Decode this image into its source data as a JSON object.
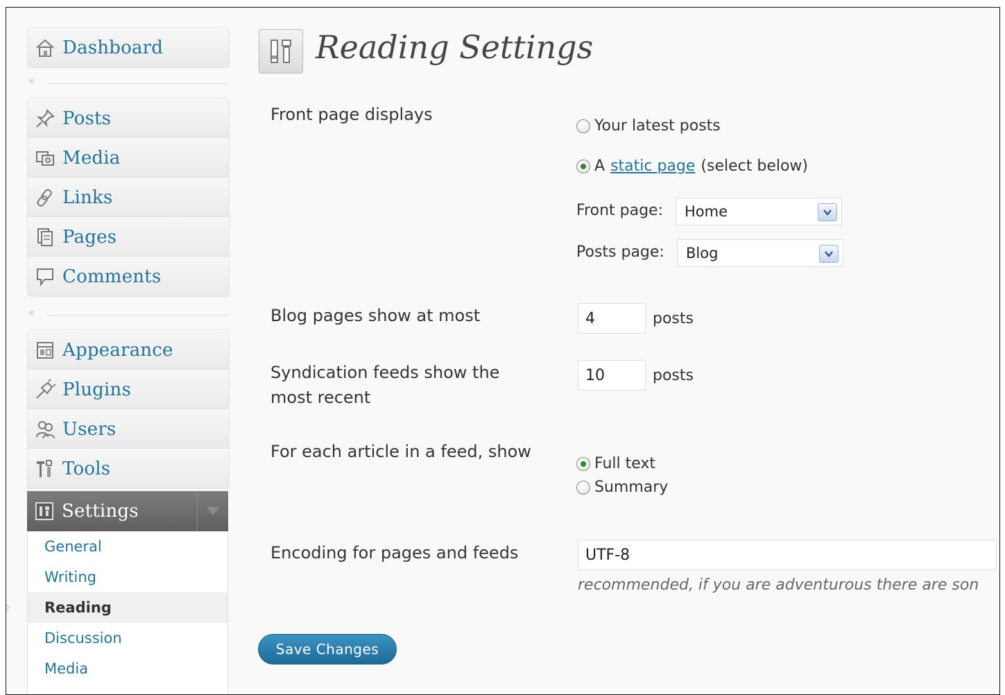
{
  "sidebar": {
    "group1": [
      {
        "label": "Dashboard",
        "icon": "house-icon"
      }
    ],
    "group2": [
      {
        "label": "Posts",
        "icon": "pushpin-icon"
      },
      {
        "label": "Media",
        "icon": "media-icon"
      },
      {
        "label": "Links",
        "icon": "link-icon"
      },
      {
        "label": "Pages",
        "icon": "pages-icon"
      },
      {
        "label": "Comments",
        "icon": "comment-bubble-icon"
      }
    ],
    "group3": [
      {
        "label": "Appearance",
        "icon": "appearance-icon"
      },
      {
        "label": "Plugins",
        "icon": "plug-icon"
      },
      {
        "label": "Users",
        "icon": "users-icon"
      },
      {
        "label": "Tools",
        "icon": "tools-icon"
      }
    ],
    "collapse_glyph": "«",
    "settings": {
      "label": "Settings",
      "submenu": [
        "General",
        "Writing",
        "Reading",
        "Discussion",
        "Media"
      ],
      "current": "Reading"
    }
  },
  "page": {
    "title": "Reading Settings",
    "front_page": {
      "label": "Front page displays",
      "option_latest": "Your latest posts",
      "option_static_prefix": "A",
      "option_static_link": "static page",
      "option_static_suffix": "(select below)",
      "selected": "static",
      "front_page_label": "Front page:",
      "front_page_value": "Home",
      "posts_page_label": "Posts page:",
      "posts_page_value": "Blog"
    },
    "blog_pages": {
      "label": "Blog pages show at most",
      "value": "4",
      "unit": "posts"
    },
    "syndication": {
      "label": "Syndication feeds show the most recent",
      "value": "10",
      "unit": "posts"
    },
    "feed_article": {
      "label": "For each article in a feed, show",
      "option_full": "Full text",
      "option_summary": "Summary",
      "selected": "full"
    },
    "encoding": {
      "label": "Encoding for pages and feeds",
      "value": "UTF-8",
      "hint": "recommended, if you are adventurous there are son"
    },
    "save_label": "Save Changes"
  },
  "colors": {
    "link": "#21759b",
    "settings_bg": "#6a6a6a",
    "button": "#21759b"
  }
}
